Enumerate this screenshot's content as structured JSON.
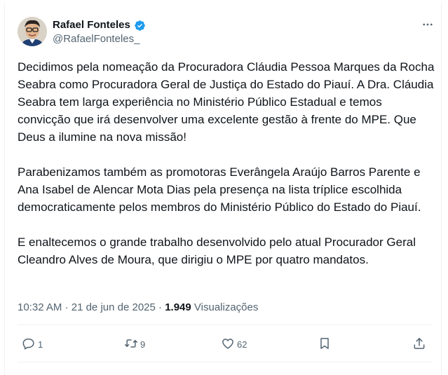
{
  "tweet": {
    "author": {
      "display_name": "Rafael Fonteles",
      "handle": "@RafaelFonteles_",
      "verified": true,
      "verified_color": "#1d9bf0"
    },
    "paragraphs": [
      "Decidimos pela nomeação da Procuradora Cláudia Pessoa Marques da Rocha Seabra como Procuradora Geral de Justiça do Estado do Piauí. A Dra. Cláudia Seabra tem larga experiência no Ministério Público Estadual e temos convicção que irá desenvolver uma excelente gestão à frente do MPE. Que Deus a ilumine na nova missão!",
      "Parabenizamos também as promotoras Everângela Araújo Barros Parente e Ana Isabel de Alencar Mota Dias pela presença na lista tríplice escolhida democraticamente pelos membros do Ministério Público do Estado do Piauí.",
      "E enaltecemos o grande trabalho desenvolvido pelo atual Procurador Geral Cleandro Alves de Moura, que dirigiu o MPE por quatro mandatos."
    ],
    "time": "10:32 AM",
    "separator": "·",
    "date": "21 de jun de 2025",
    "views_count": "1.949",
    "views_label": "Visualizações",
    "actions": {
      "reply_icon": "reply-icon",
      "reply_count": "1",
      "retweet_icon": "retweet-icon",
      "retweet_count": "9",
      "like_icon": "like-icon",
      "like_count": "62",
      "bookmark_icon": "bookmark-icon",
      "share_icon": "share-icon"
    },
    "more_icon": "more-options-icon"
  }
}
